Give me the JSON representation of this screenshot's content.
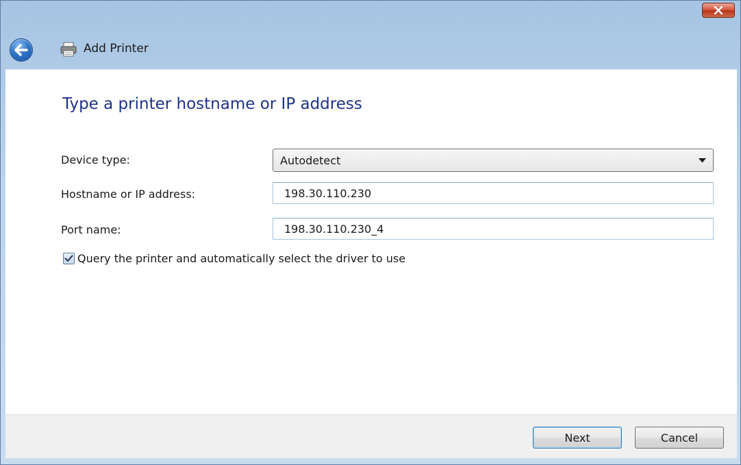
{
  "window": {
    "title": "Add Printer"
  },
  "page": {
    "heading": "Type a printer hostname or IP address"
  },
  "form": {
    "device_type": {
      "label": "Device type:",
      "value": "Autodetect"
    },
    "hostname": {
      "label": "Hostname or IP address:",
      "value": "198.30.110.230"
    },
    "port": {
      "label": "Port name:",
      "value": "198.30.110.230_4"
    },
    "query_printer": {
      "label": "Query the printer and automatically select the driver to use",
      "checked": true
    }
  },
  "footer": {
    "next_label": "Next",
    "cancel_label": "Cancel"
  },
  "icons": {
    "close": "close-icon",
    "back": "back-arrow-icon",
    "printer": "printer-icon",
    "dropdown": "chevron-down-icon",
    "check": "checkmark-icon"
  },
  "colors": {
    "heading": "#1e3287",
    "close_button": "#c8452a",
    "back_button": "#2e75c9"
  }
}
